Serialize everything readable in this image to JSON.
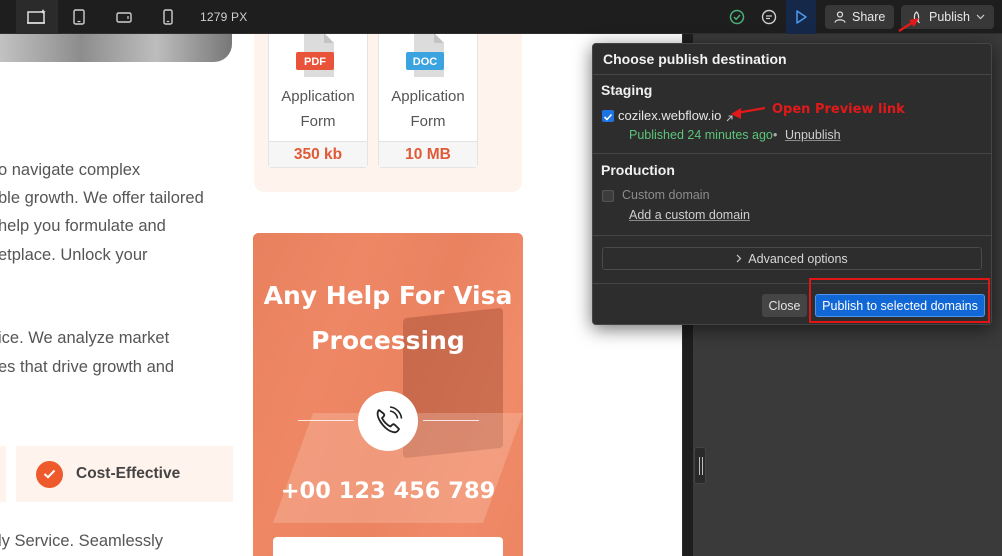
{
  "toolbar": {
    "canvas_width": "1279 PX",
    "share_label": "Share",
    "publish_label": "Publish"
  },
  "canvas": {
    "body_lines_top": [
      "o navigate complex",
      "ble growth. We offer tailored",
      "help you formulate and",
      "etplace. Unlock your"
    ],
    "body_lines_mid": [
      "ice. We analyze market",
      "es that drive growth and"
    ],
    "body_line_bottom": "ly Service. Seamlessly",
    "files": [
      {
        "badge": "PDF",
        "badge_color": "#e9533a",
        "name": "Application Form",
        "size": "350 kb"
      },
      {
        "badge": "DOC",
        "badge_color": "#3aa3e0",
        "name": "Application Form",
        "size": "10 MB"
      }
    ],
    "visa_title": "Any Help For Visa Processing",
    "visa_phone": "+00 123 456 789",
    "cost_label": "Cost-Effective"
  },
  "popup": {
    "title": "Choose publish destination",
    "staging_title": "Staging",
    "staging_domain": "cozilex.webflow.io",
    "published_status": "Published 24 minutes ago",
    "status_separator": "•",
    "unpublish_label": "Unpublish",
    "production_title": "Production",
    "custom_domain_label": "Custom domain",
    "add_domain_label": "Add a custom domain",
    "advanced_label": "Advanced options",
    "close_label": "Close",
    "publish_selected_label": "Publish to selected domains"
  },
  "annotation": {
    "preview_note": "Open Preview link"
  },
  "colors": {
    "accent_blue": "#1267d6",
    "published_green": "#5cc47a",
    "annotation_red": "#e01515",
    "brand_orange": "#ee5a2c"
  }
}
